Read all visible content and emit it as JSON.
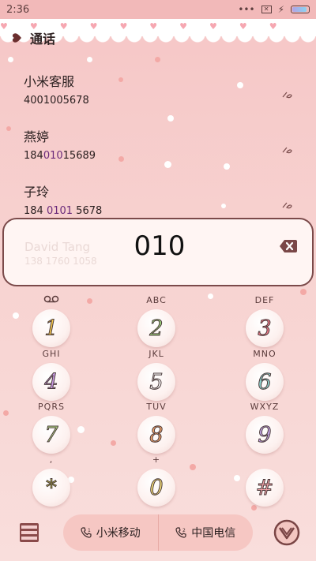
{
  "status_bar": {
    "time": "2:36",
    "charging": "⚡"
  },
  "header": {
    "title": "通话"
  },
  "recents": [
    {
      "name": "小米客服",
      "number_parts": [
        "4001005678",
        ""
      ],
      "number_hl": ""
    },
    {
      "name": "燕婷",
      "number_pre": "184",
      "number_hl": "010",
      "number_post": "15689"
    },
    {
      "name": "子玲",
      "number_pre": "184 ",
      "number_hl": "0101",
      "number_post": " 5678"
    }
  ],
  "dialer": {
    "typed_digits": "010",
    "suggestion_name": "David Tang",
    "suggestion_number": "138 1760 1058"
  },
  "keys": [
    {
      "digit": "1",
      "letters": ""
    },
    {
      "digit": "2",
      "letters": "ABC"
    },
    {
      "digit": "3",
      "letters": "DEF"
    },
    {
      "digit": "4",
      "letters": "GHI"
    },
    {
      "digit": "5",
      "letters": "JKL"
    },
    {
      "digit": "6",
      "letters": "MNO"
    },
    {
      "digit": "7",
      "letters": "PQRS"
    },
    {
      "digit": "8",
      "letters": "TUV"
    },
    {
      "digit": "9",
      "letters": "WXYZ"
    },
    {
      "digit": "*",
      "letters": ","
    },
    {
      "digit": "0",
      "letters": "+"
    },
    {
      "digit": "#",
      "letters": ""
    }
  ],
  "sim": [
    {
      "label": "小米移动",
      "slot": "1"
    },
    {
      "label": "中国电信",
      "slot": "2"
    }
  ],
  "colors": {
    "key_fill_1": "#f6c84a",
    "key_fill_2": "#9bd37a",
    "key_fill_3": "#f37b8c",
    "key_fill_4": "#c99ae6",
    "key_fill_5": "#ffffff",
    "key_fill_6": "#8fd4cf",
    "key_fill_7": "#b7e08a",
    "key_fill_8": "#f4a46b",
    "key_fill_9": "#c6a6ec",
    "key_fill_star": "#d9e34a",
    "key_fill_0": "#f9e27a",
    "key_fill_hash": "#f3a2a8"
  }
}
